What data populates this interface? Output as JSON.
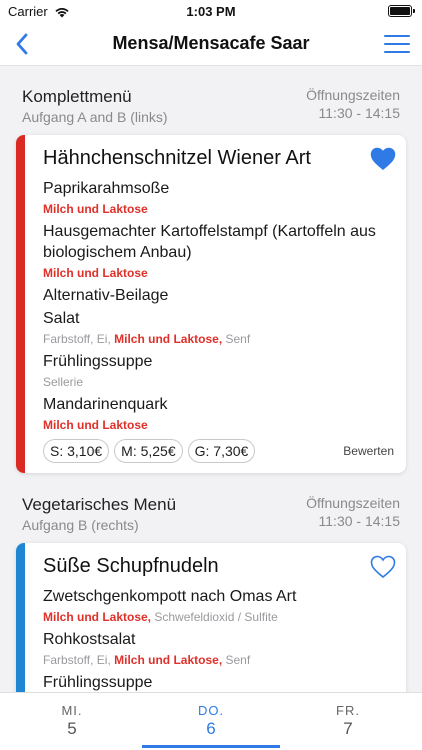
{
  "status_bar": {
    "carrier": "Carrier",
    "time": "1:03 PM"
  },
  "nav": {
    "title": "Mensa/Mensacafe Saar"
  },
  "sections": [
    {
      "title": "Komplettmenü",
      "subtitle": "Aufgang A and B (links)",
      "hours_label": "Öffnungszeiten",
      "hours": "11:30 - 14:15",
      "card": {
        "stripe_color": "#d92b23",
        "favorite": true,
        "title": "Hähnchenschnitzel Wiener Art",
        "items": [
          {
            "dish": "Paprikarahmsoße",
            "allergens_plain_before": "",
            "allergens_highlight": "Milch und Laktose",
            "allergens_plain_after": ""
          },
          {
            "dish": "Hausgemachter Kartoffelstampf (Kartoffeln aus biologischem Anbau)",
            "allergens_plain_before": "",
            "allergens_highlight": "Milch und Laktose",
            "allergens_plain_after": ""
          },
          {
            "dish": "Alternativ-Beilage"
          },
          {
            "dish": "Salat",
            "allergens_plain_before": "Farbstoff, Ei, ",
            "allergens_highlight": "Milch und Laktose,",
            "allergens_plain_after": " Senf"
          },
          {
            "dish": "Frühlingssuppe",
            "allergens_plain_before": "Sellerie",
            "allergens_highlight": "",
            "allergens_plain_after": ""
          },
          {
            "dish": "Mandarinenquark",
            "allergens_plain_before": "",
            "allergens_highlight": "Milch und Laktose",
            "allergens_plain_after": ""
          }
        ],
        "prices": [
          "S: 3,10€",
          "M: 5,25€",
          "G: 7,30€"
        ],
        "rate_label": "Bewerten"
      }
    },
    {
      "title": "Vegetarisches Menü",
      "subtitle": "Aufgang B (rechts)",
      "hours_label": "Öffnungszeiten",
      "hours": "11:30 - 14:15",
      "card": {
        "stripe_color": "#1f86d3",
        "favorite": false,
        "title": "Süße Schupfnudeln",
        "items": [
          {
            "dish": "Zwetschgenkompott nach Omas Art",
            "allergens_plain_before": "",
            "allergens_highlight": "Milch und Laktose,",
            "allergens_plain_after": " Schwefeldioxid / Sulfite"
          },
          {
            "dish": "Rohkostsalat",
            "allergens_plain_before": "Farbstoff, Ei, ",
            "allergens_highlight": "Milch und Laktose,",
            "allergens_plain_after": " Senf"
          },
          {
            "dish": "Frühlingssuppe"
          }
        ]
      }
    }
  ],
  "tabs": [
    {
      "day": "MI.",
      "num": "5"
    },
    {
      "day": "DO.",
      "num": "6"
    },
    {
      "day": "FR.",
      "num": "7"
    }
  ],
  "colors": {
    "accent": "#2f7ae5",
    "allergen_highlight": "#e0302a"
  }
}
